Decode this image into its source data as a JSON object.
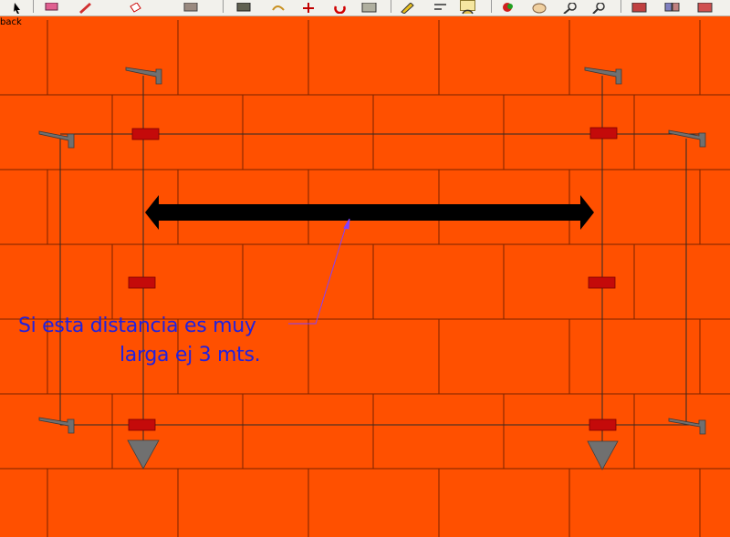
{
  "toolbar": {
    "partial_label": "back",
    "buttons": [
      {
        "name": "select-tool-button",
        "icon": "arrow-cursor-icon"
      },
      {
        "name": "eraser-tool-button",
        "icon": "eraser-icon"
      },
      {
        "name": "pencil-tool-button",
        "icon": "pencil-icon"
      },
      {
        "name": "paint-bucket-button",
        "icon": "paint-bucket-icon"
      },
      {
        "name": "rectangle-tool-button",
        "icon": "rectangle-icon"
      },
      {
        "name": "push-pull-button",
        "icon": "push-pull-icon"
      },
      {
        "name": "follow-me-button",
        "icon": "follow-me-icon"
      },
      {
        "name": "move-tool-button",
        "icon": "move-icon"
      },
      {
        "name": "rotate-tool-button",
        "icon": "rotate-icon"
      },
      {
        "name": "scale-tool-button",
        "icon": "scale-icon"
      },
      {
        "name": "tape-measure-button",
        "icon": "tape-measure-icon"
      },
      {
        "name": "dimension-tool-button",
        "icon": "dimension-icon"
      },
      {
        "name": "protractor-button",
        "icon": "protractor-icon"
      },
      {
        "name": "orbit-tool-button",
        "icon": "orbit-icon"
      },
      {
        "name": "pan-tool-button",
        "icon": "pan-hand-icon"
      },
      {
        "name": "zoom-tool-button",
        "icon": "zoom-icon"
      },
      {
        "name": "zoom-extents-button",
        "icon": "zoom-extents-icon"
      },
      {
        "name": "warehouse-button",
        "icon": "warehouse-icon"
      },
      {
        "name": "components-button",
        "icon": "components-icon"
      }
    ]
  },
  "annotation": {
    "line1": "Si esta distancia es muy",
    "line2": "larga ej 3 mts."
  },
  "colors": {
    "background": "#ff5000",
    "brick_line": "#7a2200",
    "guide_line": "#333333",
    "bracket": "#707070",
    "marker": "#c00000",
    "arrow": "#000000",
    "annotation_text": "#2222dd",
    "leader_line": "#8040ff"
  }
}
